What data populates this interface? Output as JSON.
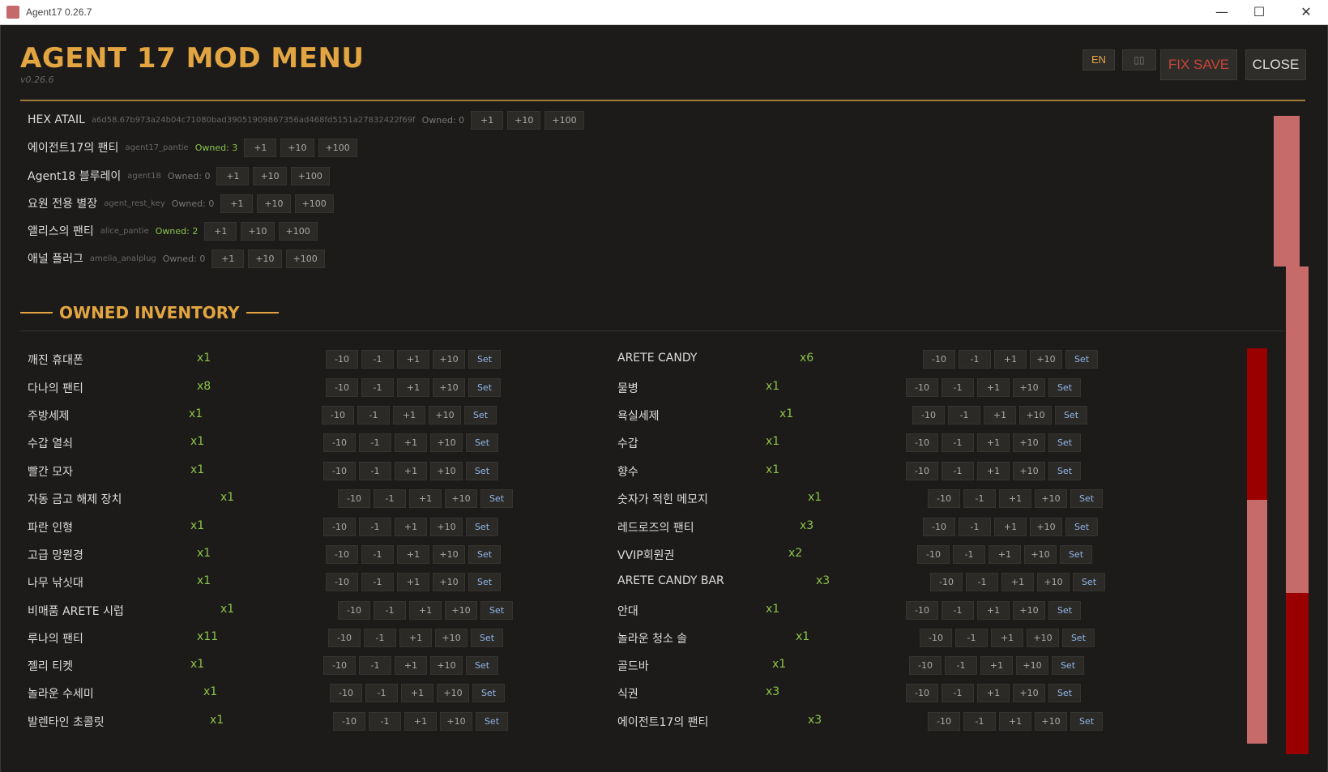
{
  "window": {
    "title": "Agent17 0.26.7",
    "minimize": "—",
    "maximize": "☐",
    "close": "✕"
  },
  "header": {
    "title": "AGENT 17 MOD MENU",
    "version": "v0.26.6",
    "lang_en": "EN",
    "lang_kr": "▯▯",
    "fix_save": "FIX SAVE",
    "close": "CLOSE"
  },
  "add_buttons": {
    "p1": "+1",
    "p10": "+10",
    "p100": "+100"
  },
  "catalog": [
    {
      "name": "HEX ATAIL",
      "id": "a6d58.67b973a24b04c71080bad39051909867356ad468fd5151a27832422f69f",
      "owned": "Owned: 0",
      "has": false
    },
    {
      "name": "에이전트17의 팬티",
      "id": "agent17_pantie",
      "owned": "Owned: 3",
      "has": true
    },
    {
      "name": "Agent18 블루레이",
      "id": "agent18",
      "owned": "Owned: 0",
      "has": false
    },
    {
      "name": "요원 전용 별장",
      "id": "agent_rest_key",
      "owned": "Owned: 0",
      "has": false
    },
    {
      "name": "앨리스의 팬티",
      "id": "alice_pantie",
      "owned": "Owned: 2",
      "has": true
    },
    {
      "name": "애널 플러그",
      "id": "amelia_analplug",
      "owned": "Owned: 0",
      "has": false
    }
  ],
  "section": {
    "title": "OWNED INVENTORY"
  },
  "inv_buttons": {
    "m10": "-10",
    "m1": "-1",
    "p1": "+1",
    "p10": "+10",
    "set": "Set"
  },
  "inventory_left": [
    {
      "name": "깨진 휴대폰",
      "qty": "x1"
    },
    {
      "name": "다나의 팬티",
      "qty": "x8"
    },
    {
      "name": "주방세제",
      "qty": "x1"
    },
    {
      "name": "수갑 열쇠",
      "qty": "x1"
    },
    {
      "name": "빨간 모자",
      "qty": "x1"
    },
    {
      "name": "자동 금고 해제 장치",
      "qty": "x1"
    },
    {
      "name": "파란 인형",
      "qty": "x1"
    },
    {
      "name": "고급 망원경",
      "qty": "x1"
    },
    {
      "name": "나무 낚싯대",
      "qty": "x1"
    },
    {
      "name": "비매품 ARETE 시럽",
      "qty": "x1"
    },
    {
      "name": "루나의 팬티",
      "qty": "x11"
    },
    {
      "name": "젤리 티켓",
      "qty": "x1"
    },
    {
      "name": "놀라운 수세미",
      "qty": "x1"
    },
    {
      "name": "발렌타인 초콜릿",
      "qty": "x1"
    }
  ],
  "inventory_right": [
    {
      "name": "ARETE CANDY",
      "qty": "x6"
    },
    {
      "name": "물병",
      "qty": "x1"
    },
    {
      "name": "욕실세제",
      "qty": "x1"
    },
    {
      "name": "수갑",
      "qty": "x1"
    },
    {
      "name": "향수",
      "qty": "x1"
    },
    {
      "name": "숫자가 적힌 메모지",
      "qty": "x1"
    },
    {
      "name": "레드로즈의 팬티",
      "qty": "x3"
    },
    {
      "name": "VVIP회원권",
      "qty": "x2"
    },
    {
      "name": "ARETE CANDY BAR",
      "qty": "x3"
    },
    {
      "name": "안대",
      "qty": "x1"
    },
    {
      "name": "놀라운 청소 솔",
      "qty": "x1"
    },
    {
      "name": "골드바",
      "qty": "x1"
    },
    {
      "name": "식권",
      "qty": "x3"
    },
    {
      "name": "에이전트17의 팬티",
      "qty": "x3"
    }
  ],
  "colors": {
    "accent": "#e2a542",
    "danger": "#c9453a",
    "owned": "#8bc34a",
    "scrollbar": "#c76a6a",
    "scroll_thumb": "#9b0000"
  }
}
